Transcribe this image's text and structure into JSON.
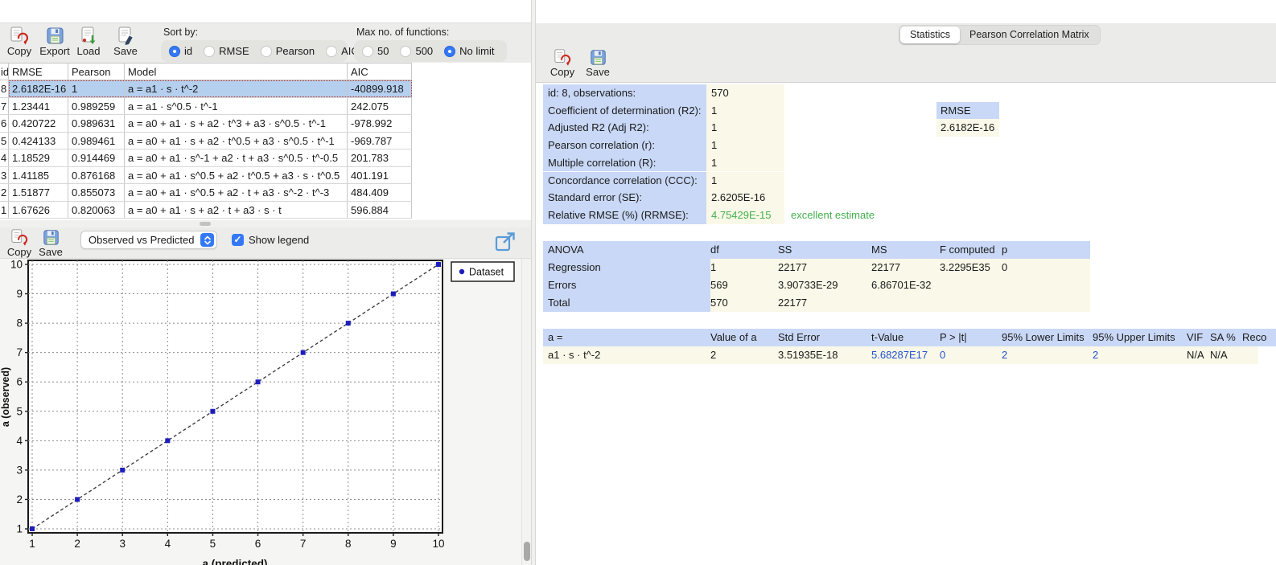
{
  "title": "a =  a1 · s · t^-2",
  "left": {
    "toolbar": {
      "copy_label": "Copy",
      "export_label": "Export",
      "load_label": "Load",
      "save_label": "Save",
      "sort_label": "Sort by:",
      "sort_options": [
        "id",
        "RMSE",
        "Pearson",
        "AIC"
      ],
      "sort_selected": "id",
      "max_label": "Max no. of functions:",
      "max_options": [
        "50",
        "500",
        "No limit"
      ],
      "max_selected": "No limit"
    },
    "table": {
      "headers": [
        "id",
        "RMSE",
        "Pearson",
        "Model",
        "AIC"
      ],
      "rows": [
        {
          "id": "8",
          "rmse": "2.6182E-16",
          "pearson": "1",
          "model": "a =  a1 · s · t^-2",
          "aic": "-40899.918",
          "selected": true
        },
        {
          "id": "7",
          "rmse": "1.23441",
          "pearson": "0.989259",
          "model": "a =  a1 · s^0.5 · t^-1",
          "aic": "242.075",
          "selected": false
        },
        {
          "id": "6",
          "rmse": "0.420722",
          "pearson": "0.989631",
          "model": "a = a0  + a1 · s + a2 · t^3 + a3 · s^0.5 · t^-1",
          "aic": "-978.992",
          "selected": false
        },
        {
          "id": "5",
          "rmse": "0.424133",
          "pearson": "0.989461",
          "model": "a = a0  + a1 · s + a2 · t^0.5 + a3 · s^0.5 · t^-1",
          "aic": "-969.787",
          "selected": false
        },
        {
          "id": "4",
          "rmse": "1.18529",
          "pearson": "0.914469",
          "model": "a = a0  + a1 · s^-1 + a2 · t + a3 · s^0.5 · t^-0.5",
          "aic": "201.783",
          "selected": false
        },
        {
          "id": "3",
          "rmse": "1.41185",
          "pearson": "0.876168",
          "model": "a = a0  + a1 · s^0.5 + a2 · t^0.5 + a3 · s · t^0.5",
          "aic": "401.191",
          "selected": false
        },
        {
          "id": "2",
          "rmse": "1.51877",
          "pearson": "0.855073",
          "model": "a = a0  + a1 · s^0.5 + a2 · t + a3 · s^-2 · t^-3",
          "aic": "484.409",
          "selected": false
        },
        {
          "id": "1",
          "rmse": "1.67626",
          "pearson": "0.820063",
          "model": "a = a0  + a1 · s + a2 · t + a3 · s · t",
          "aic": "596.884",
          "selected": false
        }
      ]
    },
    "plot_toolbar": {
      "copy_label": "Copy",
      "save_label": "Save",
      "view_select_value": "Observed vs Predicted",
      "show_legend_label": "Show legend",
      "show_legend_checked": true
    }
  },
  "chart_data": {
    "type": "scatter",
    "series": [
      {
        "name": "Dataset",
        "x": [
          1,
          2,
          3,
          4,
          5,
          6,
          7,
          8,
          9,
          10
        ],
        "y": [
          1,
          2,
          3,
          4,
          5,
          6,
          7,
          8,
          9,
          10
        ]
      }
    ],
    "title": "",
    "xlabel": "a (predicted)",
    "ylabel": "a (observed)",
    "xlim": [
      1,
      10
    ],
    "ylim": [
      1,
      10
    ],
    "xticks": [
      1,
      2,
      3,
      4,
      5,
      6,
      7,
      8,
      9,
      10
    ],
    "yticks": [
      1,
      2,
      3,
      4,
      5,
      6,
      7,
      8,
      9,
      10
    ],
    "grid": true,
    "grid_style": "dashed",
    "line_style": "dashed",
    "legend_position": "top-right",
    "marker_color": "#1d1dbb",
    "line_color": "#333333"
  },
  "right": {
    "tabs": [
      {
        "label": "Statistics",
        "selected": true
      },
      {
        "label": "Pearson Correlation Matrix",
        "selected": false
      }
    ],
    "toolbar": {
      "copy_label": "Copy",
      "save_label": "Save"
    },
    "stats": {
      "rows": [
        {
          "label": "id: 8, observations:",
          "value": "570"
        },
        {
          "label": "Coefficient of determination (R2):",
          "value": "1",
          "extra_label": "RMSE"
        },
        {
          "label": "Adjusted R2 (Adj R2):",
          "value": "1",
          "extra_value": "2.6182E-16"
        },
        {
          "label": "Pearson correlation (r):",
          "value": "1"
        },
        {
          "label": "Multiple correlation (R):",
          "value": "1"
        },
        {
          "label": "Concordance correlation (CCC):",
          "value": "1"
        },
        {
          "label": "Standard error (SE):",
          "value": "2.6205E-16"
        },
        {
          "label": "Relative RMSE (%) (RRMSE):",
          "value": "4.75429E-15",
          "note": "excellent estimate"
        }
      ]
    },
    "anova": {
      "headers": [
        "ANOVA",
        "df",
        "SS",
        "MS",
        "F computed",
        "p"
      ],
      "rows": [
        {
          "label": "Regression",
          "df": "1",
          "ss": "22177",
          "ms": "22177",
          "f": "3.2295E35",
          "p": "0"
        },
        {
          "label": "Errors",
          "df": "569",
          "ss": "3.90733E-29",
          "ms": "6.86701E-32",
          "f": "",
          "p": ""
        },
        {
          "label": "Total",
          "df": "570",
          "ss": "22177",
          "ms": "",
          "f": "",
          "p": ""
        }
      ]
    },
    "coefficients": {
      "headers": [
        "a =",
        "Value of a",
        "Std Error",
        "t-Value",
        "P > |t|",
        "95% Lower Limits",
        "95% Upper Limits",
        "VIF",
        "SA %",
        "Reco"
      ],
      "row": {
        "term": "a1 · s · t^-2",
        "value": "2",
        "std_error": "3.51935E-18",
        "t_value": "5.68287E17",
        "p": "0",
        "lower": "2",
        "upper": "2",
        "vif": "N/A",
        "sa": "N/A"
      }
    },
    "colors": {
      "accent": "#3478f6",
      "blue_cell": "#c9d8f6",
      "cream_cell": "#faf8e8",
      "good_green": "#44b04e",
      "link_blue": "#2050d0",
      "title_blue": "#1616d9"
    }
  }
}
